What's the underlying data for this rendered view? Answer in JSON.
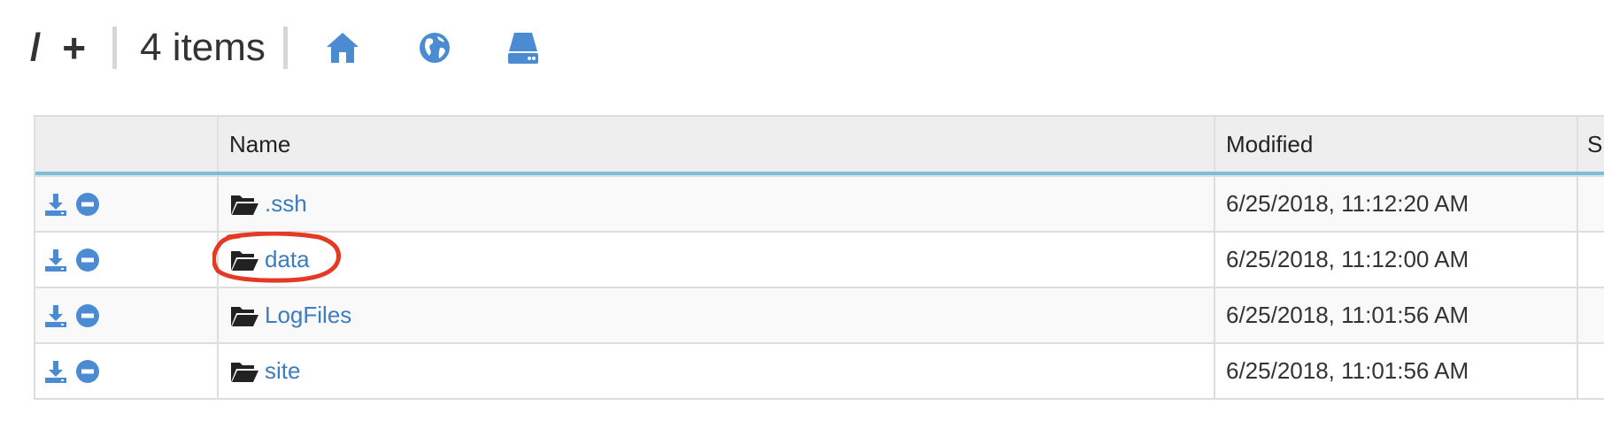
{
  "header": {
    "root_label": "/",
    "add_label": "+",
    "item_count": "4 items",
    "icons": [
      "home-icon",
      "globe-icon",
      "drive-icon"
    ]
  },
  "table": {
    "columns": [
      "Name",
      "Modified",
      "S"
    ],
    "rows": [
      {
        "name": ".ssh",
        "modified": "6/25/2018, 11:12:20 AM"
      },
      {
        "name": "data",
        "modified": "6/25/2018, 11:12:00 AM"
      },
      {
        "name": "LogFiles",
        "modified": "6/25/2018, 11:01:56 AM"
      },
      {
        "name": "site",
        "modified": "6/25/2018, 11:01:56 AM"
      }
    ],
    "row_icons": [
      "download-icon",
      "remove-icon",
      "folder-open-icon"
    ]
  },
  "colors": {
    "accent": "#3d7cbf",
    "icon_blue": "#4a8bd1",
    "header_border": "#7cbfd9",
    "annotation": "#e23a23"
  }
}
